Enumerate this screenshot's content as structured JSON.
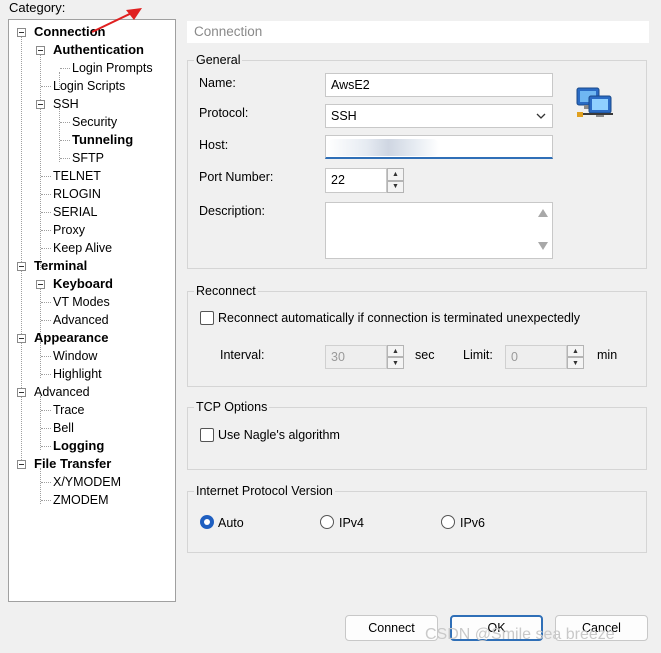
{
  "category_label": "Category:",
  "tree": [
    {
      "label": "Connection",
      "bold": true
    },
    {
      "label": "Authentication",
      "bold": true
    },
    {
      "label": "Login Prompts",
      "bold": false
    },
    {
      "label": "Login Scripts",
      "bold": false
    },
    {
      "label": "SSH",
      "bold": false
    },
    {
      "label": "Security",
      "bold": false
    },
    {
      "label": "Tunneling",
      "bold": true
    },
    {
      "label": "SFTP",
      "bold": false
    },
    {
      "label": "TELNET",
      "bold": false
    },
    {
      "label": "RLOGIN",
      "bold": false
    },
    {
      "label": "SERIAL",
      "bold": false
    },
    {
      "label": "Proxy",
      "bold": false
    },
    {
      "label": "Keep Alive",
      "bold": false
    },
    {
      "label": "Terminal",
      "bold": true
    },
    {
      "label": "Keyboard",
      "bold": true
    },
    {
      "label": "VT Modes",
      "bold": false
    },
    {
      "label": "Advanced",
      "bold": false
    },
    {
      "label": "Appearance",
      "bold": true
    },
    {
      "label": "Window",
      "bold": false
    },
    {
      "label": "Highlight",
      "bold": false
    },
    {
      "label": "Advanced",
      "bold": false
    },
    {
      "label": "Trace",
      "bold": false
    },
    {
      "label": "Bell",
      "bold": false
    },
    {
      "label": "Logging",
      "bold": true
    },
    {
      "label": "File Transfer",
      "bold": true
    },
    {
      "label": "X/YMODEM",
      "bold": false
    },
    {
      "label": "ZMODEM",
      "bold": false
    }
  ],
  "panel_title": "Connection",
  "general": {
    "title": "General",
    "name_label": "Name:",
    "name_value": "AwsE2",
    "protocol_label": "Protocol:",
    "protocol_value": "SSH",
    "host_label": "Host:",
    "host_value": "",
    "port_label": "Port Number:",
    "port_value": "22",
    "description_label": "Description:",
    "description_value": ""
  },
  "reconnect": {
    "title": "Reconnect",
    "checkbox_label": "Reconnect automatically if connection is terminated unexpectedly",
    "checked": false,
    "interval_label": "Interval:",
    "interval_value": "30",
    "interval_unit": "sec",
    "limit_label": "Limit:",
    "limit_value": "0",
    "limit_unit": "min"
  },
  "tcp": {
    "title": "TCP Options",
    "nagle_label": "Use Nagle's algorithm",
    "checked": false
  },
  "ip_version": {
    "title": "Internet Protocol Version",
    "options": [
      "Auto",
      "IPv4",
      "IPv6"
    ],
    "selected": "Auto"
  },
  "buttons": {
    "connect": "Connect",
    "ok": "OK",
    "cancel": "Cancel"
  },
  "watermark": "CSDN @Smile sea breeze",
  "colors": {
    "accent": "#2f6fb7",
    "radio_selected": "#1f5fc0",
    "annotation_arrow": "#e02020"
  }
}
